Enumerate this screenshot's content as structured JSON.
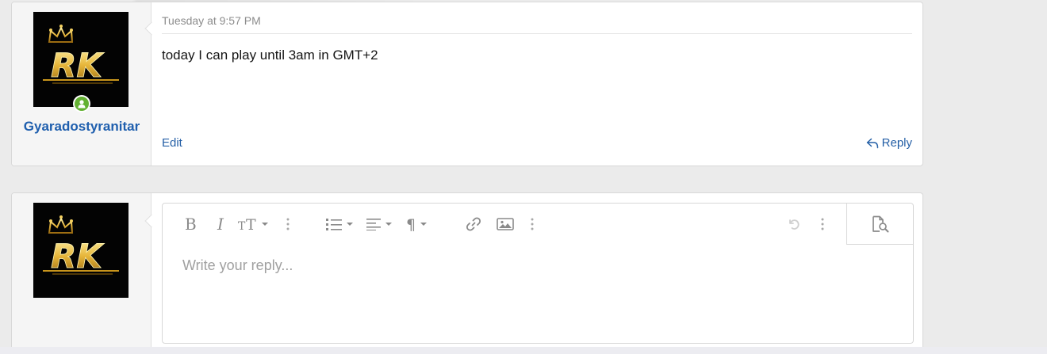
{
  "post": {
    "username": "Gyaradostyranitar",
    "avatar_text": "RK",
    "timestamp": "Tuesday at 9:57 PM",
    "message": "today I can play until 3am in GMT+2",
    "edit_label": "Edit",
    "reply_label": "Reply"
  },
  "reply_editor": {
    "placeholder": "Write your reply...",
    "toolbar": [
      "bold-icon",
      "italic-icon",
      "text-size-icon",
      "more-options-icon",
      "list-icon",
      "align-icon",
      "paragraph-icon",
      "link-icon",
      "image-icon",
      "more-options-icon",
      "undo-icon",
      "more-options-icon",
      "preview-icon"
    ]
  },
  "colors": {
    "link": "#245fa6",
    "online": "#63b132",
    "avatar_bg": "#030303",
    "avatar_gold": "#e0b030"
  }
}
